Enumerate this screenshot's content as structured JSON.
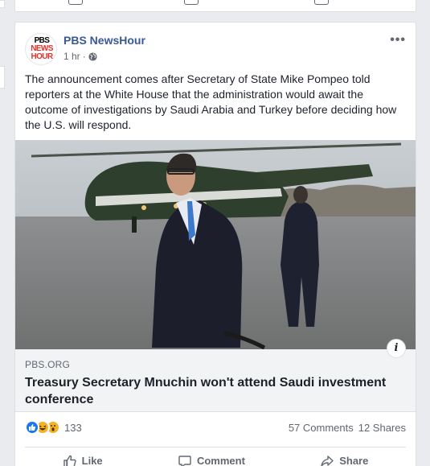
{
  "post": {
    "page_name": "PBS NewsHour",
    "logo_lines": [
      "PBS",
      "NEWS",
      "HOUR"
    ],
    "time": "1 hr",
    "separator": "·",
    "privacy_icon": "globe-icon",
    "more_label": "•••",
    "text": "The announcement comes after Secretary of State Mike Pompeo told reporters at the White House that the administration would await the outcome of investigations by Saudi Arabia and Turkey before deciding how the U.S. will respond."
  },
  "link": {
    "domain": "PBS.ORG",
    "title": "Treasury Secretary Mnuchin won't attend Saudi investment conference",
    "info_label": "i"
  },
  "engagement": {
    "reaction_icons": [
      "like-icon",
      "haha-icon",
      "wow-icon"
    ],
    "reaction_count": "133",
    "comments": "57 Comments",
    "shares": "12 Shares"
  },
  "actions": {
    "like": "Like",
    "comment": "Comment",
    "share": "Share"
  },
  "colors": {
    "page_name": "#385898",
    "like_blue": "#1877f2",
    "reaction_yellow": "#f7b125",
    "pbs_red": "#e3322c"
  }
}
